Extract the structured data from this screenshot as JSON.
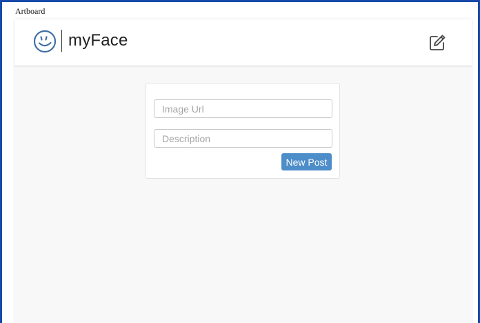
{
  "artboard": {
    "label": "Artboard"
  },
  "navbar": {
    "brand_name": "myFace",
    "logo_icon": "smiley-face-icon",
    "edit_icon": "pencil-square-icon"
  },
  "post_form": {
    "image_url_placeholder": "Image Url",
    "image_url_value": "",
    "description_placeholder": "Description",
    "description_value": "",
    "submit_label": "New Post"
  },
  "colors": {
    "accent": "#4d8dc9",
    "logo": "#3f6fa8",
    "frame": "#1649a8",
    "background": "#f8f8f8"
  }
}
